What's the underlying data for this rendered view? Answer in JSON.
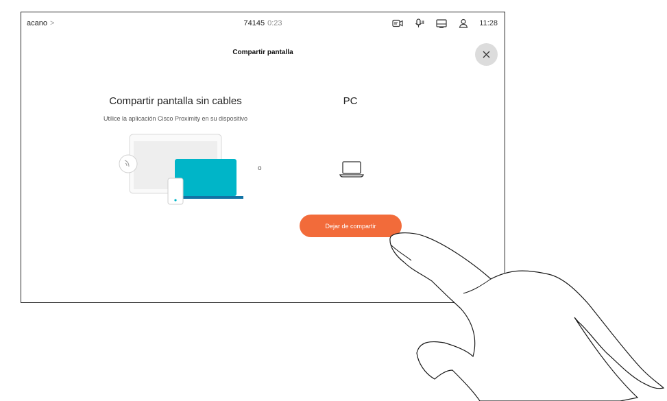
{
  "statusbar": {
    "breadcrumb": "acano",
    "breadcrumb_sep": ">",
    "call_number": "74145",
    "call_duration": "0:23",
    "time": "11:28",
    "icons": [
      "camera-icon",
      "mic-icon",
      "display-icon",
      "participants-icon"
    ]
  },
  "panel": {
    "title": "Compartir pantalla",
    "close_icon": "close-icon"
  },
  "wireless": {
    "title": "Compartir pantalla sin cables",
    "subtitle": "Utilice la aplicación Cisco Proximity en su dispositivo"
  },
  "separator": "o",
  "pc": {
    "title": "PC"
  },
  "stop_button": {
    "label": "Dejar de compartir",
    "color": "#f26b3a"
  },
  "colors": {
    "laptop_screen": "#00b5c8",
    "laptop_base": "#1273a5",
    "close_bg": "#dcdcdc"
  }
}
